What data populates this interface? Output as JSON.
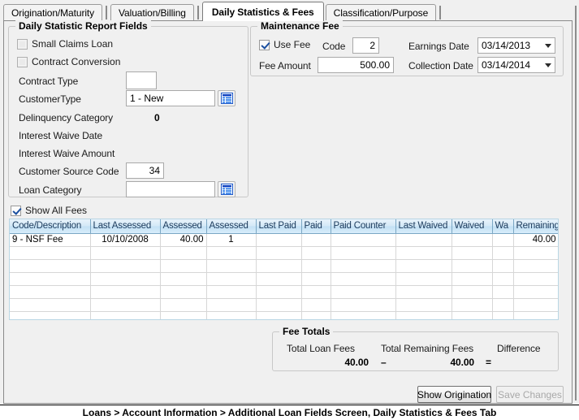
{
  "tabs": [
    {
      "label": "Origination/Maturity",
      "selected": false
    },
    {
      "label": "Valuation/Billing",
      "selected": false
    },
    {
      "label": "Daily Statistics & Fees",
      "selected": true
    },
    {
      "label": "Classification/Purpose",
      "selected": false
    }
  ],
  "daily_statistic_report_fields": {
    "title": "Daily Statistic Report Fields",
    "small_claims_loan": {
      "label": "Small Claims Loan",
      "checked": false
    },
    "contract_conversion": {
      "label": "Contract Conversion",
      "checked": false
    },
    "contract_type": {
      "label": "Contract Type",
      "value": ""
    },
    "customer_type": {
      "label": "CustomerType",
      "value": "1 - New"
    },
    "delinquency_category": {
      "label": "Delinquency Category",
      "value": "0"
    },
    "interest_waive_date": {
      "label": "Interest Waive Date",
      "value": ""
    },
    "interest_waive_amount": {
      "label": "Interest Waive Amount",
      "value": ""
    },
    "customer_source_code": {
      "label": "Customer Source Code",
      "value": "34"
    },
    "loan_category": {
      "label": "Loan Category",
      "value": ""
    }
  },
  "maintenance_fee": {
    "title": "Maintenance Fee",
    "use_fee": {
      "label": "Use Fee",
      "checked": true
    },
    "code": {
      "label": "Code",
      "value": "2"
    },
    "fee_amount": {
      "label": "Fee Amount",
      "value": "500.00"
    },
    "earnings_date": {
      "label": "Earnings Date",
      "value": "03/14/2013"
    },
    "collection_date": {
      "label": "Collection Date",
      "value": "03/14/2014"
    }
  },
  "show_all_fees": {
    "label": "Show All Fees",
    "checked": true
  },
  "fees_grid": {
    "columns": [
      "Code/Description",
      "Last Assessed",
      "Assessed",
      "Assessed",
      "Last Paid",
      "Paid",
      "Paid Counter",
      "Last Waived",
      "Waived",
      "Wa",
      "Remaining",
      ""
    ],
    "rows": [
      {
        "code_description": "9 - NSF Fee",
        "last_assessed": "10/10/2008",
        "assessed_amount": "40.00",
        "assessed_count": "1",
        "last_paid": "",
        "paid": "",
        "paid_counter": "",
        "last_waived": "",
        "waived": "",
        "waived_counter": "",
        "remaining": "40.00",
        "extra": ""
      }
    ],
    "empty_row_count": 6
  },
  "fee_totals": {
    "title": "Fee Totals",
    "total_loan_fees_label": "Total Loan Fees",
    "total_loan_fees_value": "40.00",
    "minus_operator": "–",
    "total_remaining_fees_label": "Total Remaining Fees",
    "total_remaining_fees_value": "40.00",
    "equals_operator": "=",
    "difference_label": "Difference",
    "difference_value": ""
  },
  "buttons": {
    "show_origination": {
      "label": "Show Origination",
      "enabled": true
    },
    "save_changes": {
      "label": "Save Changes",
      "enabled": false
    }
  },
  "footer": {
    "breadcrumb": "Loans > Account Information > Additional Loan Fields Screen, Daily Statistics & Fees Tab"
  },
  "colors": {
    "grid_header_text": "#1b3a5c",
    "assessed_value": "#2a2ad0",
    "remaining_value": "#d02020",
    "panel_bg": "#f0f0f0"
  }
}
